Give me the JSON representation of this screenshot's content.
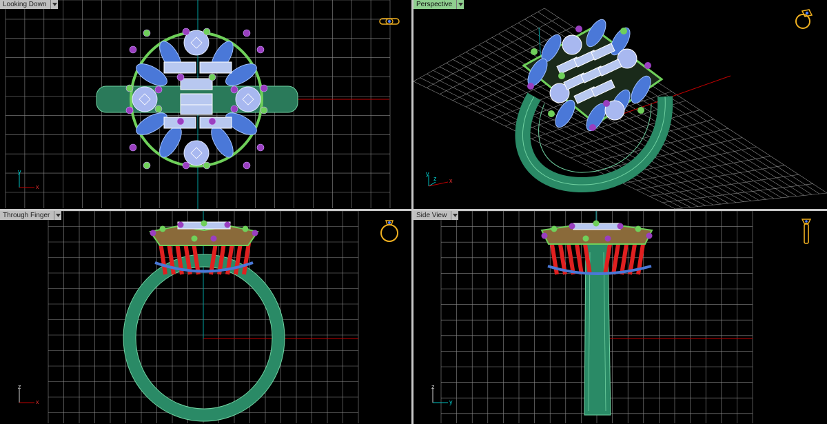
{
  "viewports": {
    "top_left": {
      "label": "Looking Down",
      "active": false,
      "axis_h": "x",
      "axis_v": "y",
      "orientation_icon": "ring-top-icon"
    },
    "top_right": {
      "label": "Perspective",
      "active": true,
      "axis_h": "x",
      "axis_v": "y",
      "axis_z": "z",
      "orientation_icon": "ring-perspective-icon"
    },
    "bottom_left": {
      "label": "Through Finger",
      "active": false,
      "axis_h": "x",
      "axis_v": "z",
      "orientation_icon": "ring-front-icon"
    },
    "bottom_right": {
      "label": "Side View",
      "active": false,
      "axis_h": "y",
      "axis_v": "z",
      "orientation_icon": "ring-side-icon"
    }
  },
  "colors": {
    "background": "#000000",
    "grid": "#8a8a8a",
    "x_axis": "#c00000",
    "y_axis": "#00a0a0",
    "shank": "#2f8f6a",
    "prong": "#6fd05a",
    "marquise": "#4a78d8",
    "round_stone": "#a8b8f0",
    "baguette": "#b8c8f0",
    "accent_bead": "#9a3fc0",
    "red_prongs": "#e02020",
    "orient_icon": "#f0b020"
  }
}
